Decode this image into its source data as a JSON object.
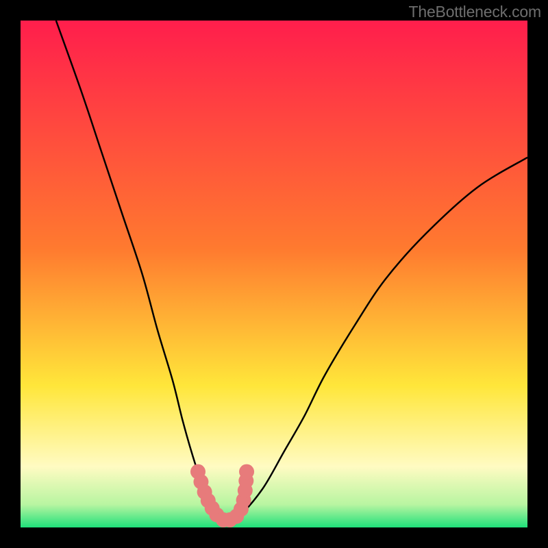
{
  "watermark": "TheBottleneck.com",
  "colors": {
    "bg": "#000000",
    "grad_top": "#ff1e4c",
    "grad_mid1": "#ff7a2f",
    "grad_mid2": "#ffe63a",
    "grad_low": "#fffbc2",
    "grad_green1": "#b8f5a1",
    "grad_green2": "#1fe07a",
    "curve": "#000000",
    "marker_fill": "#e77b7b",
    "marker_stroke": "#e77b7b"
  },
  "chart_data": {
    "type": "line",
    "title": "",
    "xlabel": "",
    "ylabel": "",
    "xlim": [
      0,
      100
    ],
    "ylim": [
      0,
      100
    ],
    "note": "No axes, ticks, grid, or legend are visible. Values are estimated from geometry alone (percent of plot width/height).",
    "series": [
      {
        "name": "curve",
        "x": [
          7,
          12,
          16,
          20,
          24,
          27,
          30,
          32,
          34,
          36,
          38,
          40,
          42,
          44,
          48,
          52,
          56,
          60,
          66,
          72,
          80,
          90,
          100
        ],
        "y": [
          100,
          86,
          74,
          62,
          50,
          39,
          29,
          21,
          14,
          8,
          4,
          1.5,
          1.5,
          3,
          8,
          15,
          22,
          30,
          40,
          49,
          58,
          67,
          73
        ]
      }
    ],
    "markers": {
      "name": "salmon-dots",
      "x_approx": [
        35.0,
        35.6,
        36.3,
        37.0,
        37.8,
        38.7,
        40.0,
        41.3,
        42.6,
        43.5,
        44.0,
        44.3,
        44.5,
        44.6
      ],
      "y_approx": [
        11.0,
        9.0,
        7.0,
        5.3,
        3.8,
        2.5,
        1.5,
        1.5,
        2.2,
        3.6,
        5.4,
        7.3,
        9.2,
        11.0
      ],
      "radius_px_approx": 11
    }
  }
}
